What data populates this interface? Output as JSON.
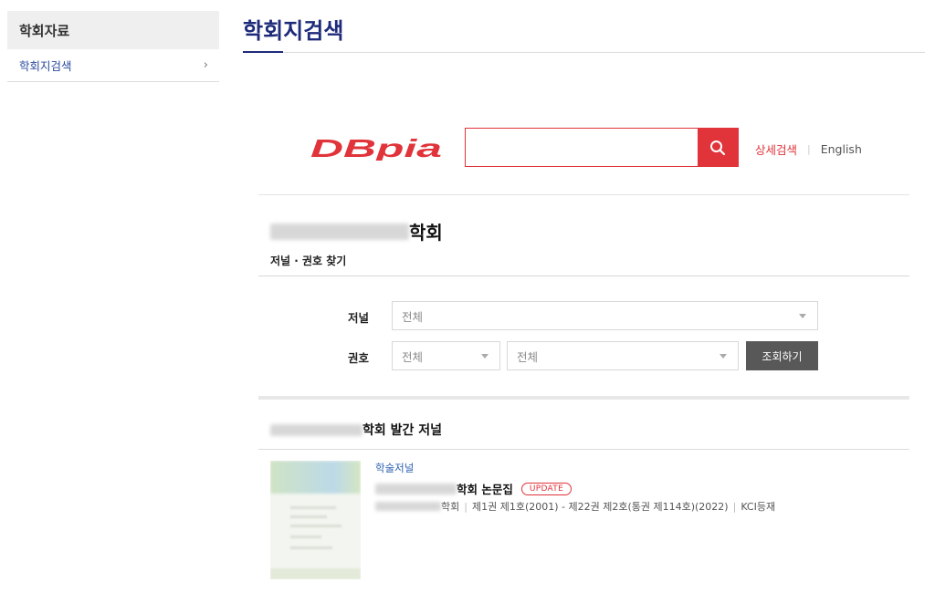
{
  "sidebar": {
    "heading": "학회자료",
    "items": [
      {
        "label": "학회지검색"
      }
    ]
  },
  "page": {
    "title": "학회지검색"
  },
  "search": {
    "logo_text": "DBpia",
    "input_value": "",
    "advanced_label": "상세검색",
    "english_label": "English",
    "accent_color": "#e0333a"
  },
  "society": {
    "name_suffix": "학회",
    "find_label": "저널 · 권호 찾기"
  },
  "filters": {
    "journal_label": "저널",
    "journal_value": "전체",
    "issue_label": "권호",
    "issue_year_value": "전체",
    "issue_number_value": "전체",
    "query_button": "조회하기"
  },
  "journals": {
    "section_suffix": "학회 발간 저널",
    "items": [
      {
        "tag": "학술저널",
        "name_suffix": "학회 논문집",
        "badge": "UPDATE",
        "meta_publisher_suffix": "학회",
        "meta_range": "제1권 제1호(2001) - 제22권 제2호(통권 제114호)(2022)",
        "meta_index": "KCI등재"
      }
    ]
  }
}
